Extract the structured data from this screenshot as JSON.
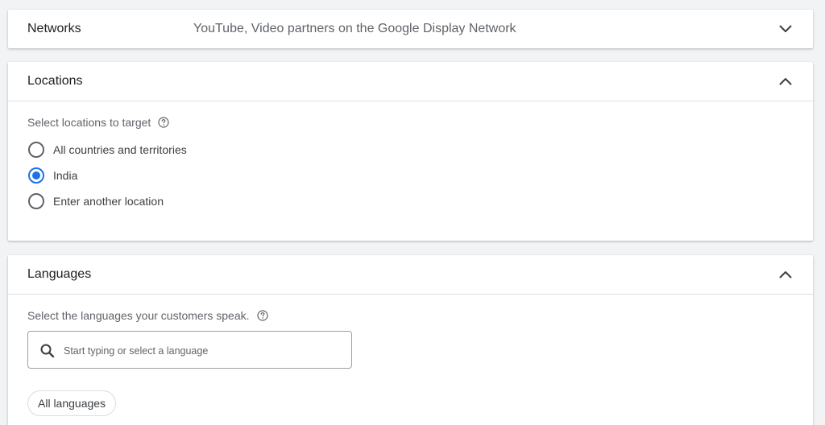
{
  "networks": {
    "title": "Networks",
    "summary": "YouTube, Video partners on the Google Display Network",
    "chevron_icon": "chevron-down-icon"
  },
  "locations": {
    "title": "Locations",
    "label": "Select locations to target",
    "help_icon": "help-circle-icon",
    "chevron_icon": "chevron-up-icon",
    "options": [
      {
        "label": "All countries and territories",
        "selected": false
      },
      {
        "label": "India",
        "selected": true
      },
      {
        "label": "Enter another location",
        "selected": false
      }
    ]
  },
  "languages": {
    "title": "Languages",
    "label": "Select the languages your customers speak.",
    "help_icon": "help-circle-icon",
    "chevron_icon": "chevron-up-icon",
    "search_placeholder": "Start typing or select a language",
    "chip_label": "All languages"
  },
  "colors": {
    "accent": "#1a73e8",
    "radio_border": "#5f6368",
    "background": "#f1f3f4",
    "card": "#ffffff"
  }
}
